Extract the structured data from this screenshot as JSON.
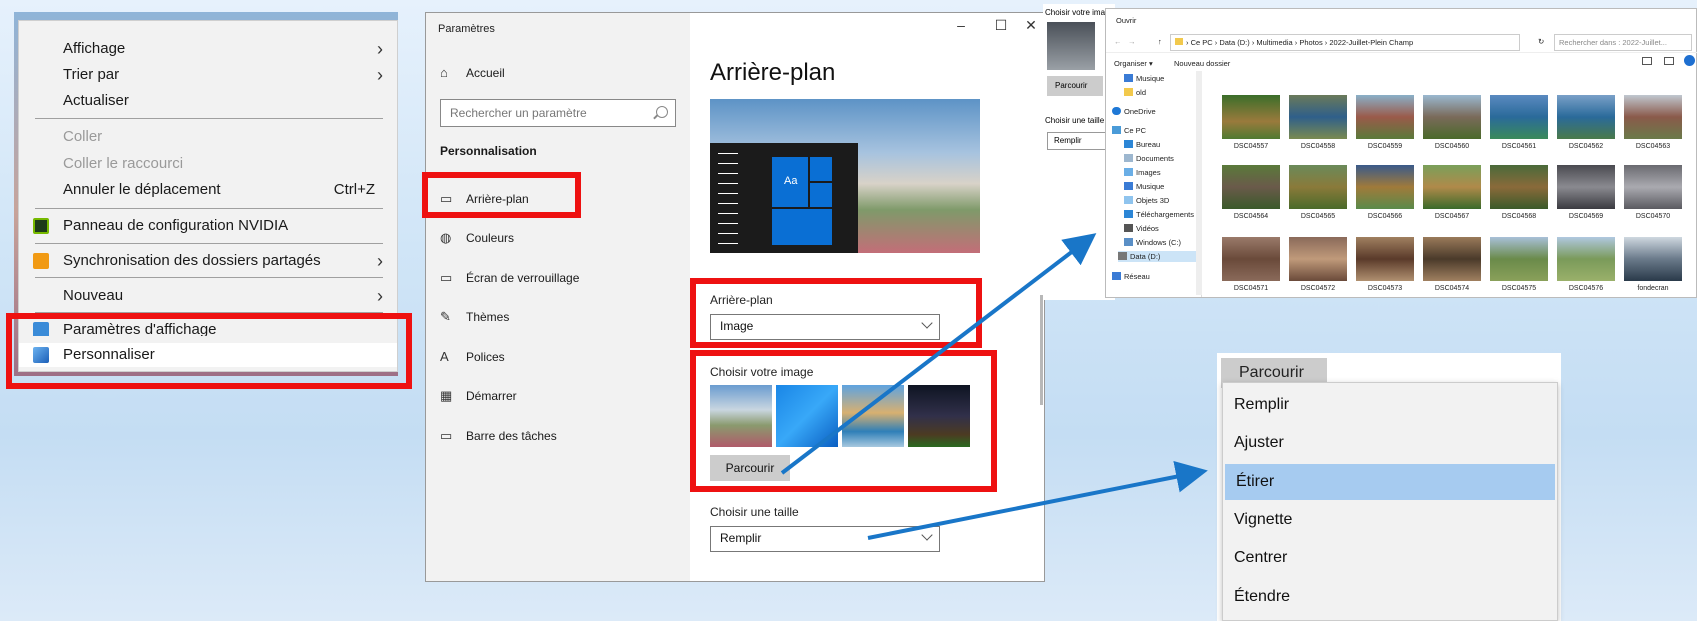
{
  "context_menu": {
    "items": [
      {
        "label": "Affichage",
        "arrow": true
      },
      {
        "label": "Trier par",
        "arrow": true
      },
      {
        "label": "Actualiser"
      },
      {
        "label": "Coller",
        "disabled": true
      },
      {
        "label": "Coller le raccourci",
        "disabled": true
      },
      {
        "label": "Annuler le déplacement",
        "shortcut": "Ctrl+Z"
      },
      {
        "label": "Panneau de configuration NVIDIA",
        "icon": "nvidia-icon"
      },
      {
        "label": "Synchronisation des dossiers partagés",
        "icon": "sync-icon",
        "arrow": true
      },
      {
        "label": "Nouveau",
        "arrow": true
      },
      {
        "label": "Paramètres d'affichage",
        "icon": "display-icon"
      },
      {
        "label": "Personnaliser",
        "icon": "personalize-icon"
      }
    ],
    "arrow_glyph": "›"
  },
  "settings": {
    "window_title": "Paramètres",
    "controls": {
      "minimize": "–",
      "maximize": "☐",
      "close": "✕"
    },
    "home": "Accueil",
    "search_placeholder": "Rechercher un paramètre",
    "section": "Personnalisation",
    "nav": [
      {
        "label": "Arrière-plan",
        "icon": "image-icon",
        "glyph": "▭"
      },
      {
        "label": "Couleurs",
        "icon": "palette-icon",
        "glyph": "◍"
      },
      {
        "label": "Écran de verrouillage",
        "icon": "lockscreen-icon",
        "glyph": "▭"
      },
      {
        "label": "Thèmes",
        "icon": "themes-icon",
        "glyph": "✎"
      },
      {
        "label": "Polices",
        "icon": "fonts-icon",
        "glyph": "A"
      },
      {
        "label": "Démarrer",
        "icon": "start-icon",
        "glyph": "▦"
      },
      {
        "label": "Barre des tâches",
        "icon": "taskbar-icon",
        "glyph": "▭"
      }
    ],
    "page_title": "Arrière-plan",
    "preview_tile": "Aa",
    "background_label": "Arrière-plan",
    "background_value": "Image",
    "choose_image_label": "Choisir votre image",
    "browse_label": "Parcourir",
    "size_label": "Choisir une taille",
    "size_value": "Remplir"
  },
  "peek": {
    "choose_label": "Choisir votre ima",
    "browse_label": "Parcourir",
    "size_label": "Choisir une taille",
    "size_value": "Remplir"
  },
  "explorer": {
    "title": "Ouvrir",
    "breadcrumb": "›  Ce PC  ›  Data (D:)  ›  Multimedia  ›  Photos  ›  2022-Juillet-Plein Champ",
    "search_placeholder": "Rechercher dans : 2022-Juillet...",
    "organize": "Organiser ▾",
    "new_folder": "Nouveau dossier",
    "tree": [
      "Musique",
      "old",
      "OneDrive",
      "Ce PC",
      "Bureau",
      "Documents",
      "Images",
      "Musique",
      "Objets 3D",
      "Téléchargements",
      "Vidéos",
      "Windows (C:)",
      "Data (D:)",
      "Réseau"
    ],
    "files": [
      "DSC04557",
      "DSC04558",
      "DSC04559",
      "DSC04560",
      "DSC04561",
      "DSC04562",
      "DSC04563",
      "DSC04564",
      "DSC04565",
      "DSC04566",
      "DSC04567",
      "DSC04568",
      "DSC04569",
      "DSC04570",
      "DSC04571",
      "DSC04572",
      "DSC04573",
      "DSC04574",
      "DSC04575",
      "DSC04576",
      "fondecran"
    ]
  },
  "dropdown": {
    "browse_label": "Parcourir",
    "options": [
      "Remplir",
      "Ajuster",
      "Étirer",
      "Vignette",
      "Centrer",
      "Étendre"
    ],
    "selected": "Étirer"
  },
  "colors": {
    "highlight": "#ee1111",
    "arrow": "#1976c8",
    "selected": "#a6cbf0"
  }
}
